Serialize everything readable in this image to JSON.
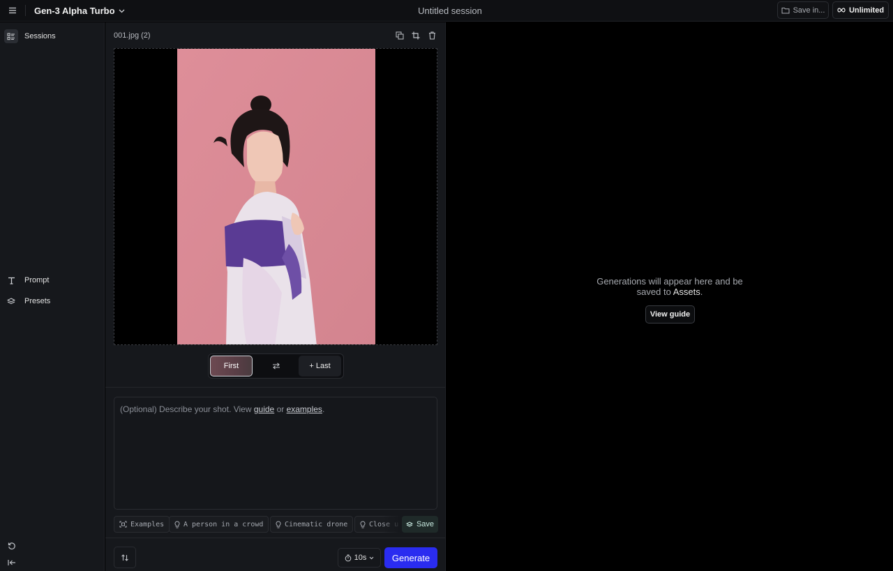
{
  "header": {
    "model_name": "Gen-3 Alpha Turbo",
    "session_title": "Untitled session",
    "save_in_label": "Save in...",
    "plan_label": "Unlimited"
  },
  "sidebar": {
    "items": [
      {
        "label": "Sessions",
        "icon": "sessions-icon",
        "active": true
      },
      {
        "label": "Prompt",
        "icon": "text-icon"
      },
      {
        "label": "Presets",
        "icon": "layers-icon"
      }
    ]
  },
  "editor": {
    "file_name": "001.jpg (2)",
    "first_label": "First",
    "last_label": "+ Last",
    "prompt_placeholder_start": "(Optional) Describe your shot. View ",
    "prompt_link_guide": "guide",
    "prompt_or": " or ",
    "prompt_link_examples": "examples",
    "prompt_end": ".",
    "chips": [
      {
        "label": "Examples",
        "icon": "examples-icon"
      },
      {
        "label": "A person in a crowd",
        "icon": "bulb-icon"
      },
      {
        "label": "Cinematic drone",
        "icon": "bulb-icon"
      },
      {
        "label": "Close u",
        "icon": "bulb-icon"
      }
    ],
    "save_label": "Save",
    "duration": "10s",
    "generate_label": "Generate"
  },
  "output": {
    "empty_text_1": "Generations will appear here and be saved to ",
    "empty_text_assets": "Assets",
    "empty_text_end": ".",
    "view_guide_label": "View guide"
  },
  "colors": {
    "accent": "#2a2cf0",
    "photo_background": "#d98c98"
  }
}
